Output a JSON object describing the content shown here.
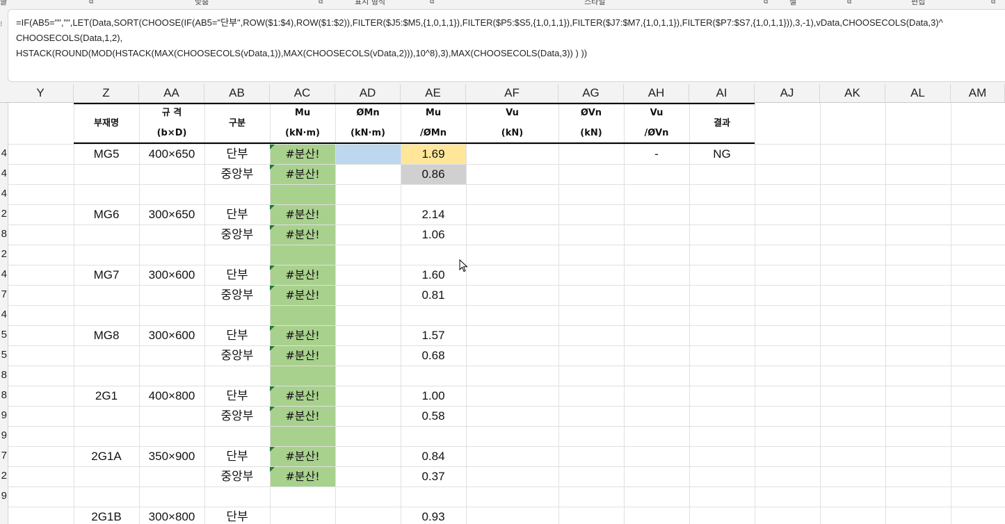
{
  "ribbon": {
    "groups": [
      "글",
      "맞춤",
      "표시 형식",
      "스타일",
      "셀",
      "편집"
    ]
  },
  "formula": {
    "lines": [
      "=IF(AB5=\"\",\"\",LET(Data,SORT(CHOOSE(IF(AB5=\"단부\",ROW($1:$4),ROW($1:$2)),FILTER($J5:$M5,{1,0,1,1}),FILTER($P5:$S5,{1,0,1,1}),FILTER($J7:$M7,{1,0,1,1}),FILTER($P7:$S7,{1,0,1,1})),3,-1),vData,CHOOSECOLS(Data,3)^",
      "CHOOSECOLS(Data,1,2),",
      "HSTACK(ROUND(MOD(HSTACK(MAX(CHOOSECOLS(vData,1)),MAX(CHOOSECOLS(vData,2))),10^8),3),MAX(CHOOSECOLS(Data,3)) ) ))"
    ]
  },
  "columns": [
    "Y",
    "Z",
    "AA",
    "AB",
    "AC",
    "AD",
    "AE",
    "AF",
    "AG",
    "AH",
    "AI",
    "AJ",
    "AK",
    "AL",
    "AM"
  ],
  "row_numbers": [
    "4",
    "4",
    "4",
    "2",
    "8",
    "2",
    "4",
    "7",
    "4",
    "5",
    "5",
    "8",
    "8",
    "9",
    "9",
    "7",
    "2",
    "9",
    ""
  ],
  "header": {
    "member": "부재명",
    "size_top": "규 격",
    "size_bottom": "(b×D)",
    "type": "구분",
    "mu_top": "Mu",
    "mu_bottom": "(kN·m)",
    "phimn_top": "ØMn",
    "phimn_bottom": "(kN·m)",
    "ratio_top": "Mu",
    "ratio_bottom": "/ØMn",
    "vu_top": "Vu",
    "vu_bottom": "(kN)",
    "phivn_top": "ØVn",
    "phivn_bottom": "(kN)",
    "vratio_top": "Vu",
    "vratio_bottom": "/ØVn",
    "result": "결과"
  },
  "rows": [
    {
      "member": "MG5",
      "size": "400×650",
      "type": "단부",
      "mu": "#분산!",
      "ratio": "1.69",
      "vratio": "-",
      "result": "NG"
    },
    {
      "member": "",
      "size": "",
      "type": "중앙부",
      "mu": "#분산!",
      "ratio": "0.86",
      "vratio": "",
      "result": ""
    },
    {
      "member": "",
      "size": "",
      "type": "",
      "mu": "",
      "ratio": "",
      "vratio": "",
      "result": ""
    },
    {
      "member": "MG6",
      "size": "300×650",
      "type": "단부",
      "mu": "#분산!",
      "ratio": "2.14",
      "vratio": "",
      "result": ""
    },
    {
      "member": "",
      "size": "",
      "type": "중앙부",
      "mu": "#분산!",
      "ratio": "1.06",
      "vratio": "",
      "result": ""
    },
    {
      "member": "",
      "size": "",
      "type": "",
      "mu": "",
      "ratio": "",
      "vratio": "",
      "result": ""
    },
    {
      "member": "MG7",
      "size": "300×600",
      "type": "단부",
      "mu": "#분산!",
      "ratio": "1.60",
      "vratio": "",
      "result": ""
    },
    {
      "member": "",
      "size": "",
      "type": "중앙부",
      "mu": "#분산!",
      "ratio": "0.81",
      "vratio": "",
      "result": ""
    },
    {
      "member": "",
      "size": "",
      "type": "",
      "mu": "",
      "ratio": "",
      "vratio": "",
      "result": ""
    },
    {
      "member": "MG8",
      "size": "300×600",
      "type": "단부",
      "mu": "#분산!",
      "ratio": "1.57",
      "vratio": "",
      "result": ""
    },
    {
      "member": "",
      "size": "",
      "type": "중앙부",
      "mu": "#분산!",
      "ratio": "0.68",
      "vratio": "",
      "result": ""
    },
    {
      "member": "",
      "size": "",
      "type": "",
      "mu": "",
      "ratio": "",
      "vratio": "",
      "result": ""
    },
    {
      "member": "2G1",
      "size": "400×800",
      "type": "단부",
      "mu": "#분산!",
      "ratio": "1.00",
      "vratio": "",
      "result": ""
    },
    {
      "member": "",
      "size": "",
      "type": "중앙부",
      "mu": "#분산!",
      "ratio": "0.58",
      "vratio": "",
      "result": ""
    },
    {
      "member": "",
      "size": "",
      "type": "",
      "mu": "",
      "ratio": "",
      "vratio": "",
      "result": ""
    },
    {
      "member": "2G1A",
      "size": "350×900",
      "type": "단부",
      "mu": "#분산!",
      "ratio": "0.84",
      "vratio": "",
      "result": ""
    },
    {
      "member": "",
      "size": "",
      "type": "중앙부",
      "mu": "#분산!",
      "ratio": "0.37",
      "vratio": "",
      "result": ""
    },
    {
      "member": "",
      "size": "",
      "type": "",
      "mu": "",
      "ratio": "",
      "vratio": "",
      "result": ""
    },
    {
      "member": "2G1B",
      "size": "300×800",
      "type": "단부",
      "mu": "",
      "ratio": "0.93",
      "vratio": "",
      "result": ""
    }
  ],
  "colors": {
    "spill_green": "#a9d18e",
    "selected_blue": "#bdd7ee",
    "highlight_yellow": "#ffe699",
    "highlight_gray": "#d0d0d0",
    "error_marker": "#1e7b36"
  },
  "icons": {
    "cursor": "mouse-pointer-icon",
    "error_marker": "error-triangle-icon"
  }
}
